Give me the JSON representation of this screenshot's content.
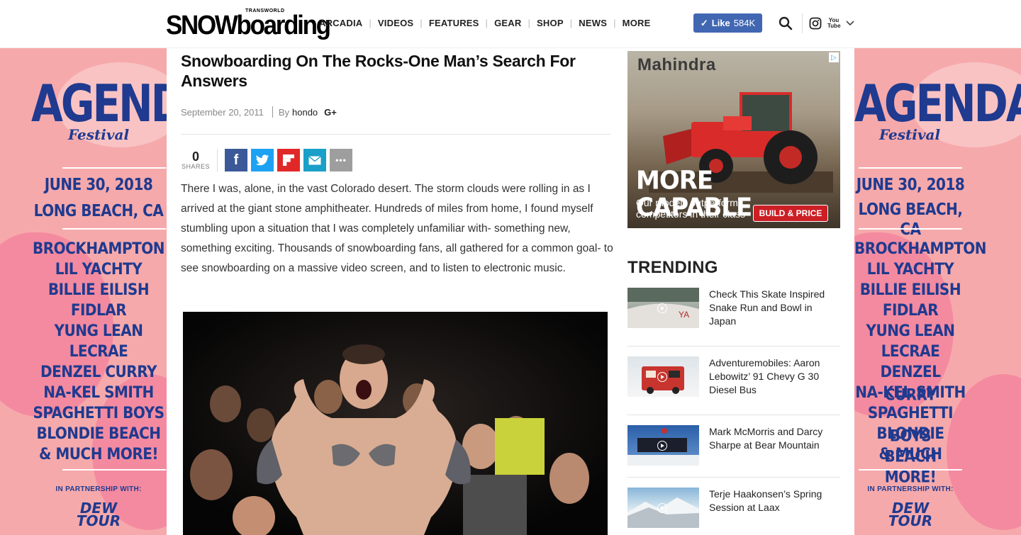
{
  "header": {
    "logo_small": "TRANSWORLD",
    "logo_main": "SNOWboarding",
    "nav": [
      "ARCADIA",
      "VIDEOS",
      "FEATURES",
      "GEAR",
      "SHOP",
      "NEWS",
      "MORE"
    ],
    "like_label": "Like",
    "like_count": "584K",
    "youtube_label": "You Tube"
  },
  "side_ad": {
    "title": "AGENDA",
    "subtitle": "Festival",
    "date": "JUNE 30, 2018",
    "location": "LONG BEACH, CA",
    "acts": [
      "BROCKHAMPTON",
      "LIL YACHTY",
      "BILLIE EILISH",
      "FIDLAR",
      "YUNG LEAN",
      "LECRAE",
      "DENZEL CURRY",
      "NA-KEL SMITH",
      "SPAGHETTI BOYS",
      "BLONDIE BEACH",
      "& MUCH MORE!"
    ],
    "partnership": "IN PARTNERSHIP WITH:",
    "sponsor_line1": "DEW",
    "sponsor_line2": "TOUR",
    "colors": {
      "background": "#f6a9ab",
      "text": "#1f3a8f"
    }
  },
  "article": {
    "title": "Snowboarding On The Rocks-One Man’s Search For Answers",
    "date": "September 20, 2011",
    "by": "By",
    "author": "hondo",
    "gplus": "G+",
    "shares_count": "0",
    "shares_label": "SHARES",
    "share_buttons": [
      {
        "icon": "facebook-icon",
        "glyph": "f",
        "color": "#3b5998"
      },
      {
        "icon": "twitter-icon",
        "glyph": "t",
        "color": "#1da1f2"
      },
      {
        "icon": "flipboard-icon",
        "glyph": "F",
        "color": "#e12828"
      },
      {
        "icon": "email-icon",
        "glyph": "✉",
        "color": "#1a9fc8"
      },
      {
        "icon": "more-icon",
        "glyph": "•••",
        "color": "#9e9e9e"
      }
    ],
    "body": "There I was, alone, in the vast Colorado desert. The storm clouds were rolling in as I arrived at the giant stone amphitheater. Hundreds of miles from home, I found myself stumbling upon a situation that I was completely unfamiliar with- something new, something exciting. Thousands of snowboarding fans, all gathered for a common goal- to see snowboarding on a massive video screen, and to listen to electronic music."
  },
  "ad_mahindra": {
    "brand": "Mahindra",
    "headline": "MORE CAPABLE.",
    "sub_line1": "Our models outperform",
    "sub_line2": "competitors in their class",
    "cta": "BUILD & PRICE",
    "adchoices": "▷"
  },
  "trending": {
    "heading": "TRENDING",
    "items": [
      {
        "title": "Check This Skate Inspired Snake Run and Bowl in Japan"
      },
      {
        "title": "Adventuremobiles: Aaron Lebowitz’ 91 Chevy G 30 Diesel Bus"
      },
      {
        "title": "Mark McMorris and Darcy Sharpe at Bear Mountain"
      },
      {
        "title": "Terje Haakonsen’s Spring Session at Laax"
      }
    ]
  }
}
